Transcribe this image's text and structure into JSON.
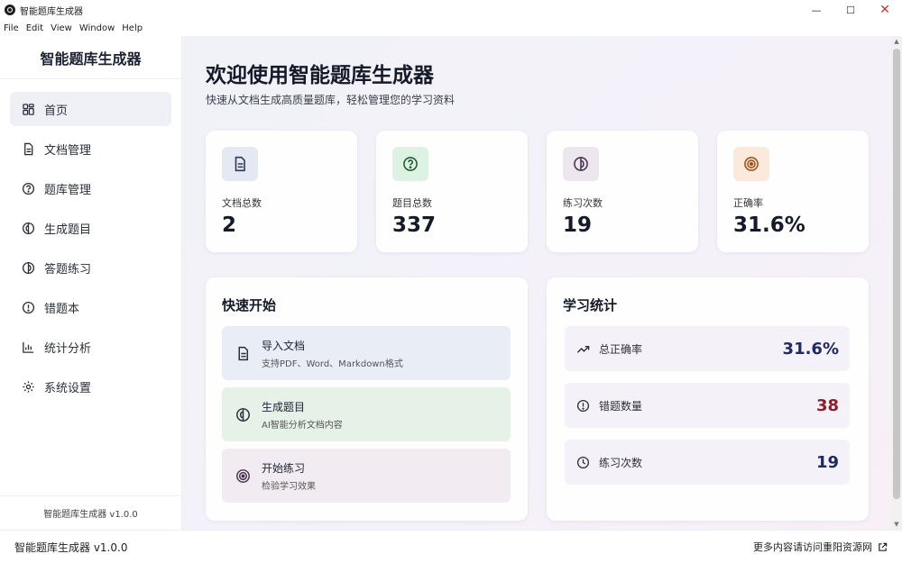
{
  "window": {
    "title": "智能题库生成器"
  },
  "menu": [
    "File",
    "Edit",
    "View",
    "Window",
    "Help"
  ],
  "sidebar": {
    "brand": "智能题库生成器",
    "items": [
      {
        "label": "首页",
        "icon": "dashboard-icon",
        "active": true
      },
      {
        "label": "文档管理",
        "icon": "document-icon"
      },
      {
        "label": "题库管理",
        "icon": "question-icon"
      },
      {
        "label": "生成题目",
        "icon": "generate-icon"
      },
      {
        "label": "答题练习",
        "icon": "practice-icon"
      },
      {
        "label": "错题本",
        "icon": "error-icon"
      },
      {
        "label": "统计分析",
        "icon": "chart-icon"
      },
      {
        "label": "系统设置",
        "icon": "gear-icon"
      }
    ],
    "version": "智能题库生成器 v1.0.0"
  },
  "main": {
    "title": "欢迎使用智能题库生成器",
    "subtitle": "快速从文档生成高质量题库，轻松管理您的学习资料",
    "stats": [
      {
        "label": "文档总数",
        "value": "2",
        "icon": "document-icon",
        "bg": "#e4e9f3"
      },
      {
        "label": "题目总数",
        "value": "337",
        "icon": "question-icon",
        "bg": "#def2e3"
      },
      {
        "label": "练习次数",
        "value": "19",
        "icon": "practice-icon",
        "bg": "#ece6ef"
      },
      {
        "label": "正确率",
        "value": "31.6%",
        "icon": "target-icon",
        "bg": "#fbe9dc"
      }
    ],
    "quick_start": {
      "title": "快速开始",
      "items": [
        {
          "title": "导入文档",
          "desc": "支持PDF、Word、Markdown格式",
          "icon": "document-icon",
          "bg": "#e9edf6"
        },
        {
          "title": "生成题目",
          "desc": "AI智能分析文档内容",
          "icon": "generate-icon",
          "bg": "#e6f1e8"
        },
        {
          "title": "开始练习",
          "desc": "检验学习效果",
          "icon": "target-icon",
          "bg": "#f2ebf2"
        }
      ]
    },
    "study_stats": {
      "title": "学习统计",
      "rows": [
        {
          "label": "总正确率",
          "value": "31.6%",
          "icon": "trend-icon",
          "color": "#1f2a63"
        },
        {
          "label": "错题数量",
          "value": "38",
          "icon": "alert-icon",
          "color": "#8a1f2d"
        },
        {
          "label": "练习次数",
          "value": "19",
          "icon": "clock-icon",
          "color": "#1f2a63"
        }
      ]
    }
  },
  "statusbar": {
    "left": "智能题库生成器 v1.0.0",
    "right": "更多内容请访问重阳资源网"
  }
}
